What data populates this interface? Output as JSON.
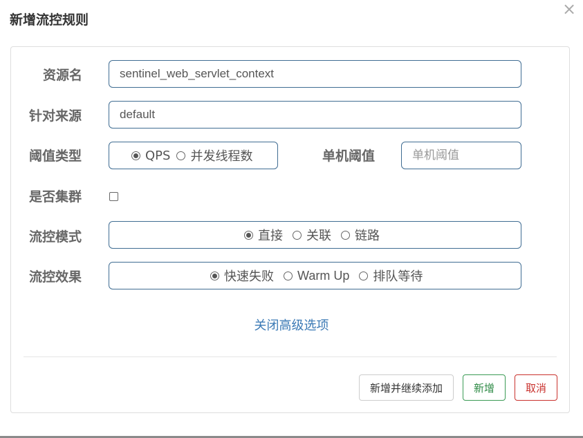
{
  "dialog": {
    "title": "新增流控规则",
    "close_symbol": "×"
  },
  "form": {
    "resource": {
      "label": "资源名",
      "value": "sentinel_web_servlet_context"
    },
    "origin": {
      "label": "针对来源",
      "value": "default"
    },
    "threshold_type": {
      "label": "阈值类型",
      "options": [
        "QPS",
        "并发线程数"
      ],
      "selected": "QPS"
    },
    "single_threshold": {
      "label": "单机阈值",
      "placeholder": "单机阈值",
      "value": ""
    },
    "cluster": {
      "label": "是否集群",
      "checked": false
    },
    "flow_mode": {
      "label": "流控模式",
      "options": [
        "直接",
        "关联",
        "链路"
      ],
      "selected": "直接"
    },
    "flow_effect": {
      "label": "流控效果",
      "options": [
        "快速失败",
        "Warm Up",
        "排队等待"
      ],
      "selected": "快速失败"
    }
  },
  "advanced_link": "关闭高级选项",
  "buttons": {
    "add_continue": "新增并继续添加",
    "add": "新增",
    "cancel": "取消"
  },
  "colors": {
    "field_border": "#3f6c92",
    "link": "#3a79b5",
    "add_green": "#2d8a45",
    "cancel_red": "#c9302c"
  }
}
